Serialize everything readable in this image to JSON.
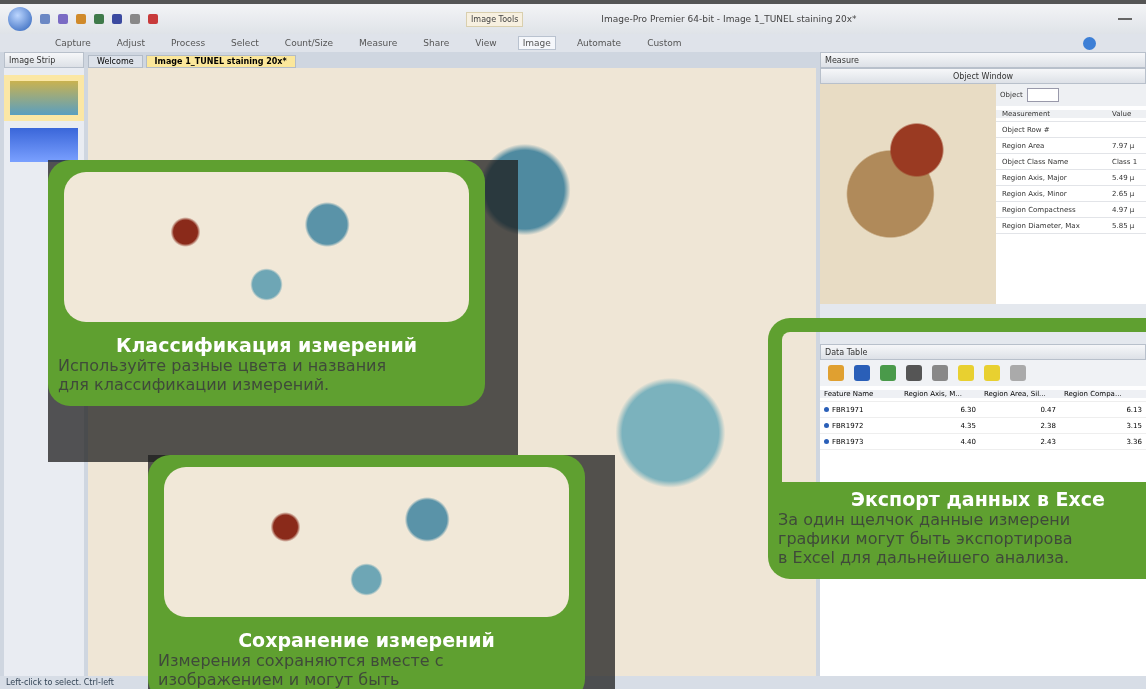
{
  "title_bar": {
    "contextual_tab": "Image Tools",
    "title": "Image-Pro Premier 64-bit - Image 1_TUNEL staining 20x*"
  },
  "ribbon_tabs": [
    {
      "label": "Capture",
      "selected": false
    },
    {
      "label": "Adjust",
      "selected": false
    },
    {
      "label": "Process",
      "selected": false
    },
    {
      "label": "Select",
      "selected": false
    },
    {
      "label": "Count/Size",
      "selected": false
    },
    {
      "label": "Measure",
      "selected": false
    },
    {
      "label": "Share",
      "selected": false
    },
    {
      "label": "View",
      "selected": false
    },
    {
      "label": "Image",
      "selected": true
    },
    {
      "label": "Automate",
      "selected": false
    },
    {
      "label": "Custom",
      "selected": false
    }
  ],
  "image_strip": {
    "title": "Image Strip",
    "thumbnails": [
      {
        "selected": true
      },
      {
        "selected": false
      }
    ]
  },
  "document_tabs": [
    {
      "label": "Welcome",
      "selected": false
    },
    {
      "label": "Image 1_TUNEL staining 20x*",
      "selected": true
    }
  ],
  "measure_panel": {
    "title": "Measure",
    "object_window": {
      "title": "Object Window",
      "object_label": "Object",
      "columns": [
        "Measurement",
        "Value"
      ],
      "rows": [
        {
          "name": "Object Row #"
        },
        {
          "name": "Region Area",
          "value": "7.97 µ"
        },
        {
          "name": "Object Class Name",
          "value": "Class 1"
        },
        {
          "name": "Region Axis, Major",
          "value": "5.49 µ"
        },
        {
          "name": "Region Axis, Minor",
          "value": "2.65 µ"
        },
        {
          "name": "Region Compactness",
          "value": "4.97 µ"
        },
        {
          "name": "Region Diameter, Max",
          "value": "5.85 µ"
        }
      ]
    }
  },
  "data_table": {
    "title": "Data Table",
    "columns": [
      "Feature Name",
      "Region Axis, M...",
      "Region Area, Sil...",
      "Region Compa..."
    ],
    "rows": [
      {
        "cells": [
          "FBR1971",
          "6.30",
          "0.47",
          "6.13"
        ]
      },
      {
        "cells": [
          "FBR1972",
          "4.35",
          "2.38",
          "3.15"
        ]
      },
      {
        "cells": [
          "FBR1973",
          "4.40",
          "2.43",
          "3.36"
        ]
      }
    ]
  },
  "callouts": [
    {
      "kind": "zoom",
      "title": "Классификация измерений",
      "lines": [
        "Используйте разные цвета и названия",
        "для классификации измерений."
      ]
    },
    {
      "kind": "zoom",
      "title": "Сохранение измерений",
      "lines": [
        "Измерения сохраняются вместе с",
        "изображением и могут быть"
      ]
    },
    {
      "kind": "window",
      "title": "Экспорт данных в Exce",
      "lines": [
        "За один щелчок данные измерени",
        "графики могут быть экспортирова",
        "в Excel для дальнейшего анализа."
      ]
    }
  ],
  "status_bar": {
    "hint": "Left-click to select. Ctrl-left"
  }
}
